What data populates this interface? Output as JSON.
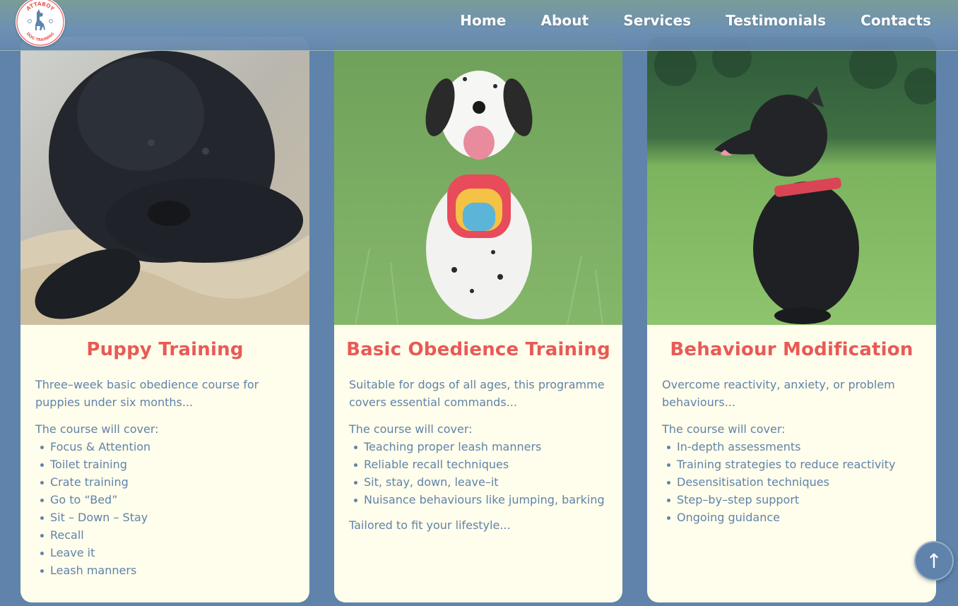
{
  "nav": {
    "logo_top_text": "ATTABOY",
    "logo_bottom_text": "DOG TRAINING",
    "items": [
      {
        "label": "Home"
      },
      {
        "label": "About"
      },
      {
        "label": "Services"
      },
      {
        "label": "Testimonials"
      },
      {
        "label": "Contacts"
      }
    ]
  },
  "colors": {
    "page_background": "#5f83ab",
    "card_background": "#fffdeb",
    "title_accent": "#e85a55",
    "body_text": "#5f83ab"
  },
  "cards": [
    {
      "title": "Puppy Training",
      "photo_icon": "black-puppy-photo",
      "description": "Three–week basic obedience course for puppies under six months...",
      "cover_label": "The course will cover:",
      "items": [
        "Focus & Attention",
        "Toilet training",
        "Crate training",
        "Go to “Bed”",
        "Sit – Down – Stay",
        "Recall",
        "Leave it",
        "Leash manners"
      ],
      "note": ""
    },
    {
      "title": "Basic Obedience Training",
      "photo_icon": "dalmatian-photo",
      "description": "Suitable for dogs of all ages, this programme covers essential commands...",
      "cover_label": "The course will cover:",
      "items": [
        "Teaching proper leash manners",
        "Reliable recall techniques",
        "Sit, stay, down, leave–it",
        "Nuisance behaviours like jumping, barking"
      ],
      "note": "Tailored to fit your lifestyle..."
    },
    {
      "title": "Behaviour Modification",
      "photo_icon": "black-dog-photo",
      "description": "Overcome reactivity, anxiety, or problem behaviours...",
      "cover_label": "The course will cover:",
      "items": [
        "In-depth assessments",
        "Training strategies to reduce reactivity",
        "Desensitisation techniques",
        "Step–by–step support",
        "Ongoing guidance"
      ],
      "note": ""
    }
  ],
  "back_to_top": {
    "glyph": "↑"
  }
}
